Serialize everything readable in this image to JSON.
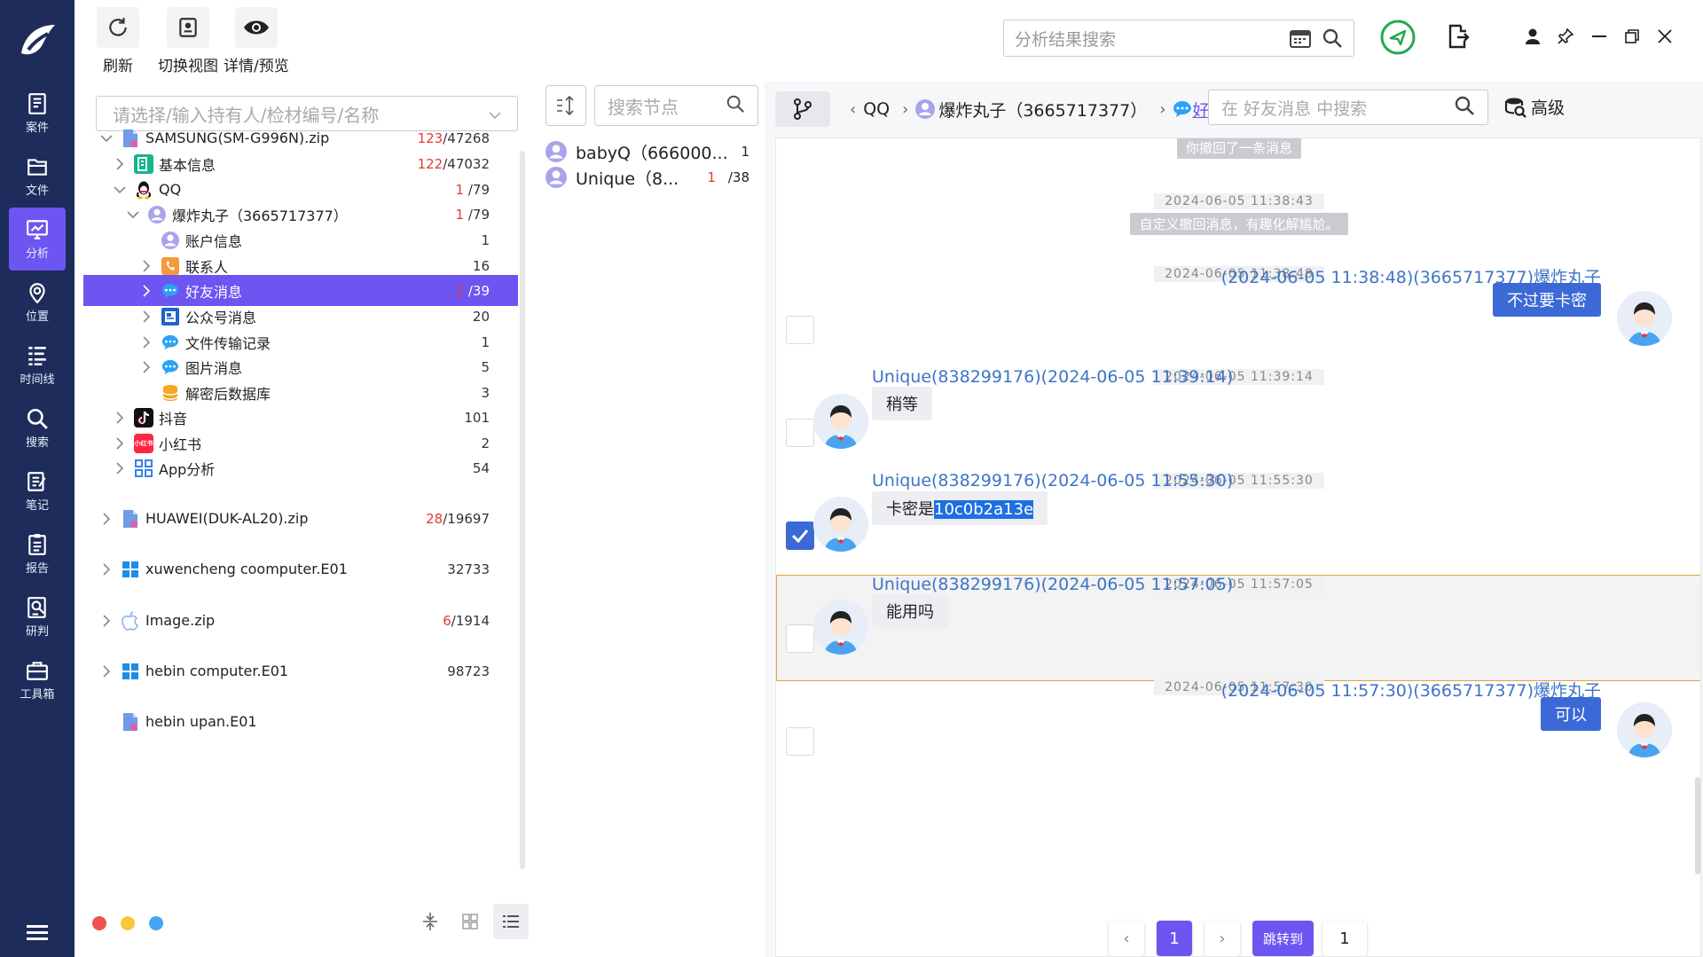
{
  "nav": {
    "items": [
      {
        "label": "案件",
        "icon": "case-icon"
      },
      {
        "label": "文件",
        "icon": "folder-icon"
      },
      {
        "label": "分析",
        "icon": "analysis-icon"
      },
      {
        "label": "位置",
        "icon": "location-icon"
      },
      {
        "label": "时间线",
        "icon": "timeline-icon"
      },
      {
        "label": "搜索",
        "icon": "search-icon"
      },
      {
        "label": "笔记",
        "icon": "note-icon"
      },
      {
        "label": "报告",
        "icon": "report-icon"
      },
      {
        "label": "研判",
        "icon": "judge-icon"
      },
      {
        "label": "工具箱",
        "icon": "toolbox-icon"
      }
    ],
    "active_index": 2,
    "accent": "#6c55f0",
    "bg": "#1d2c5b"
  },
  "toolbar": {
    "refresh_label": "刷新",
    "switch_view_label": "切换视图",
    "detail_label": "详情/预览",
    "search_placeholder": "分析结果搜索"
  },
  "tree": {
    "holder_placeholder": "请选择/输入持有人/检材编号/名称",
    "rows": [
      {
        "label": "SAMSUNG(SM-G996N).zip",
        "red": "123",
        "rest": "/47268",
        "icon": "zip-file-icon"
      },
      {
        "label": "基本信息",
        "red": "122",
        "rest": "/47032",
        "icon": "basic-info-icon"
      },
      {
        "label": "QQ",
        "red": "1",
        "rest": " /79",
        "icon": "qq-icon"
      },
      {
        "label": "爆炸丸子（3665717377）",
        "red": "1",
        "rest": " /79",
        "icon": "user-icon"
      },
      {
        "label": "账户信息",
        "red": "",
        "rest": "1",
        "icon": "account-icon"
      },
      {
        "label": "联系人",
        "red": "",
        "rest": "16",
        "icon": "contacts-icon"
      },
      {
        "label": "好友消息",
        "red": "1",
        "rest": " /39",
        "icon": "message-icon"
      },
      {
        "label": "公众号消息",
        "red": "",
        "rest": "20",
        "icon": "official-account-icon"
      },
      {
        "label": "文件传输记录",
        "red": "",
        "rest": "1",
        "icon": "file-transfer-icon"
      },
      {
        "label": "图片消息",
        "red": "",
        "rest": "5",
        "icon": "image-message-icon"
      },
      {
        "label": "解密后数据库",
        "red": "",
        "rest": "3",
        "icon": "database-icon"
      },
      {
        "label": "抖音",
        "red": "",
        "rest": "101",
        "icon": "douyin-icon"
      },
      {
        "label": "小红书",
        "red": "",
        "rest": "2",
        "icon": "xiaohongshu-icon"
      },
      {
        "label": "App分析",
        "red": "",
        "rest": "54",
        "icon": "app-grid-icon"
      },
      {
        "label": "HUAWEI(DUK-AL20).zip",
        "red": "28",
        "rest": "/19697",
        "icon": "zip-file-icon"
      },
      {
        "label": "xuwencheng coomputer.E01",
        "red": "",
        "rest": "32733",
        "icon": "windows-icon"
      },
      {
        "label": "Image.zip",
        "red": "6",
        "rest": "/1914",
        "icon": "apple-icon"
      },
      {
        "label": "hebin computer.E01",
        "red": "",
        "rest": "98723",
        "icon": "windows-icon"
      },
      {
        "label": "hebin upan.E01",
        "red": "",
        "rest": "",
        "icon": "zip-file-icon"
      }
    ],
    "xiaohongshu_logo_text": "小红书"
  },
  "mid": {
    "search_placeholder": "搜索节点",
    "rows": [
      {
        "label": "babyQ（666000...",
        "red": "",
        "rest": "1"
      },
      {
        "label": "Unique（8...",
        "red": "1",
        "rest": "/38"
      }
    ]
  },
  "right": {
    "crumbs": [
      "QQ",
      "爆炸丸子（3665717377）",
      "好友消息"
    ],
    "search_placeholder": "在 好友消息 中搜索",
    "advanced_label": "高级"
  },
  "chat": {
    "recalled_notice": "你撤回了一条消息",
    "messages": [
      {
        "timestamp": "2024-06-05 11:38:43",
        "system": "自定义撤回消息，有趣化解尴尬。"
      },
      {
        "timestamp": "2024-06-05 11:38:48",
        "sender": "(2024-06-05 11:38:48)(3665717377)爆炸丸子",
        "text": "不过要卡密",
        "dir": "out"
      },
      {
        "timestamp": "2024-06-05 11:39:14",
        "sender": "Unique(838299176)(2024-06-05 11:39:14)",
        "text": "稍等",
        "dir": "in"
      },
      {
        "timestamp": "2024-06-05 11:55:30",
        "sender": "Unique(838299176)(2024-06-05 11:55:30)",
        "text_prefix": "卡密是",
        "text_highlight": "10c0b2a13e",
        "dir": "in",
        "checked": true
      },
      {
        "timestamp": "2024-06-05 11:57:05",
        "sender": "Unique(838299176)(2024-06-05 11:57:05)",
        "text": "能用吗",
        "dir": "in"
      },
      {
        "timestamp": "2024-06-05 11:57:30",
        "sender": "(2024-06-05 11:57:30)(3665717377)爆炸丸子",
        "text": "可以",
        "dir": "out"
      }
    ]
  },
  "pager": {
    "current": "1",
    "jump_label": "跳转到",
    "jump_value": "1"
  }
}
